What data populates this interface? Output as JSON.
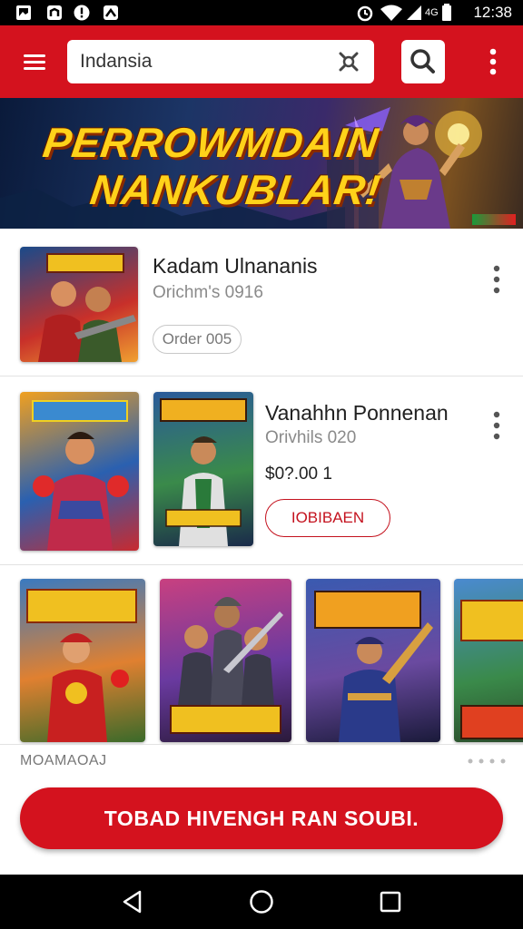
{
  "status_bar": {
    "time": "12:38",
    "network_label": "4G"
  },
  "app_bar": {
    "search_value": "Indansia",
    "menu_icon": "hamburger-icon",
    "search_icon": "search-icon",
    "more_icon": "more-vert-icon"
  },
  "banner": {
    "line1": "PERROWMDAIN",
    "line2": "NANKUBLAR!"
  },
  "list": [
    {
      "title": "Kadam Ulnananis",
      "subtitle": "Orichm's 0916",
      "button": "Order 005"
    },
    {
      "title": "Vanahhn Ponnenan",
      "subtitle": "Orivhils 020",
      "price": "$0?.00 1",
      "button": "IOBIBAEN"
    }
  ],
  "section": {
    "label": "MOAMAOAJ"
  },
  "cta": {
    "label": "TOBAD HIVENGH RAN SOUBI."
  },
  "colors": {
    "accent": "#d4121e",
    "banner_text": "#ffd21a"
  }
}
